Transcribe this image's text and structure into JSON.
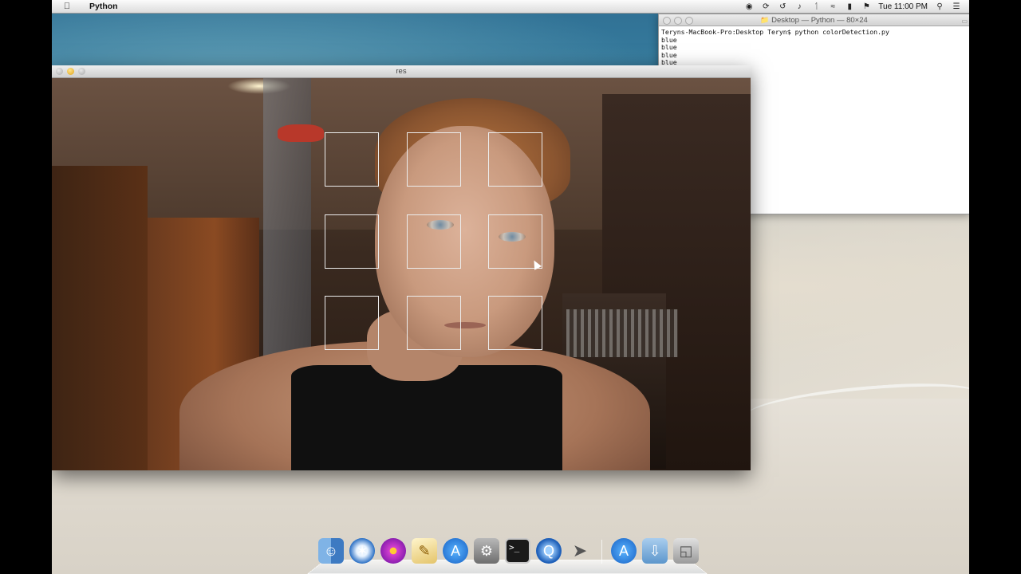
{
  "menubar": {
    "app_name": "Python",
    "clock": "Tue 11:00 PM",
    "icons": [
      "record-icon",
      "sync-icon",
      "time-machine-icon",
      "volume-icon",
      "bluetooth-icon",
      "wifi-icon",
      "battery-icon",
      "flag-icon",
      "spotlight-icon",
      "list-icon"
    ]
  },
  "terminal": {
    "title": "Desktop — Python — 80×24",
    "lines": [
      "Teryns-MacBook-Pro:Desktop Teryn$ python colorDetection.py",
      "blue",
      "blue",
      "blue",
      "blue"
    ]
  },
  "res_window": {
    "title": "res"
  },
  "dock": {
    "items": [
      "finder-icon",
      "safari-icon",
      "photo-flower-icon",
      "textedit-icon",
      "app-store-icon",
      "system-preferences-icon",
      "terminal-icon",
      "quicktime-icon",
      "rocket-icon",
      "app-store-folder-icon",
      "downloads-folder-icon",
      "trash-icon"
    ],
    "terminal_prompt": ">_"
  },
  "colors": {
    "box_border": "#ececec",
    "menubar": "#e8e8e8",
    "accent_min": "#e0a41b"
  }
}
